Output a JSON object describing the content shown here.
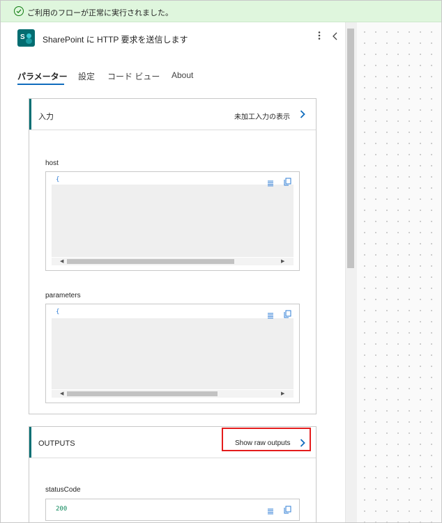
{
  "banner": {
    "message": "ご利用のフローが正常に実行されました。",
    "status_color": "#107c10"
  },
  "action": {
    "icon": "sharepoint-icon",
    "icon_letter": "S",
    "title": "SharePoint に HTTP 要求を送信します",
    "more_icon": "more-vertical-icon",
    "collapse_icon": "chevron-left-icon"
  },
  "tabs": [
    {
      "label": "パラメーター",
      "active": true
    },
    {
      "label": "設定",
      "active": false
    },
    {
      "label": "コード ビュー",
      "active": false
    },
    {
      "label": "About",
      "active": false
    }
  ],
  "inputs_card": {
    "title": "入力",
    "link_label": "未加工入力の表示",
    "fields": [
      {
        "label": "host",
        "brace": "{"
      },
      {
        "label": "parameters",
        "brace": "{"
      }
    ]
  },
  "outputs_card": {
    "title": "OUTPUTS",
    "link_label": "Show raw outputs",
    "fields": [
      {
        "label": "statusCode",
        "value": "200"
      }
    ]
  },
  "colors": {
    "accent_tab": "#0f6cbd",
    "card_accent": "#006f74",
    "link_chevron": "#0f6cbd",
    "highlight": "#e41c1c",
    "code_number": "#098658"
  }
}
